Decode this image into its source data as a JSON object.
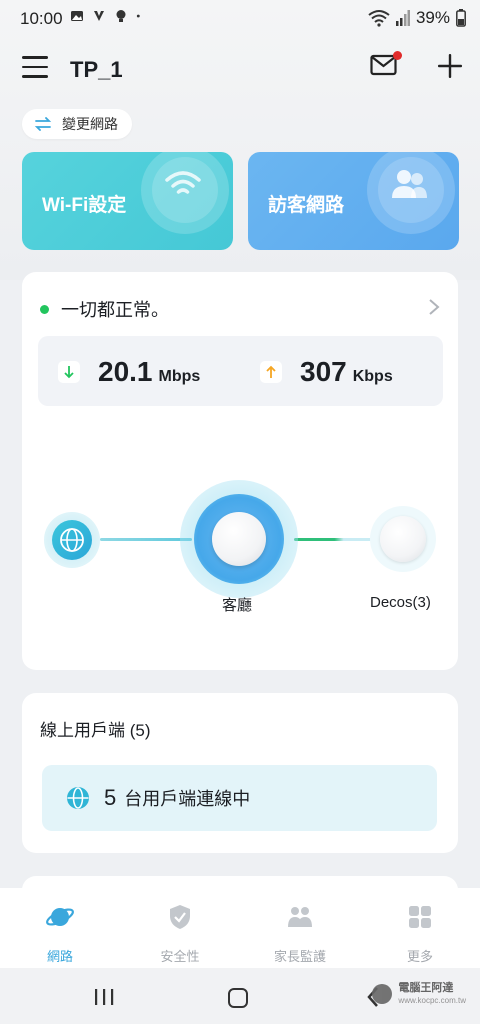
{
  "status_bar": {
    "time": "10:00",
    "battery": "39%"
  },
  "header": {
    "title": "TP_1",
    "menu_icon": "hamburger-icon",
    "mail_icon": "mail-icon",
    "add_icon": "plus-icon"
  },
  "change_network": {
    "label": "變更網路",
    "icon": "swap-icon"
  },
  "quick_cards": [
    {
      "label": "Wi-Fi設定",
      "icon": "wifi-icon",
      "color": "#4fcfda"
    },
    {
      "label": "訪客網路",
      "icon": "guests-icon",
      "color": "#62aff0"
    }
  ],
  "network_status": {
    "status_text": "一切都正常。",
    "status_color": "#22c55e",
    "download": {
      "value": "20.1",
      "unit": "Mbps",
      "icon": "arrow-down-icon"
    },
    "upload": {
      "value": "307",
      "unit": "Kbps",
      "icon": "arrow-up-icon"
    }
  },
  "topology": {
    "internet_icon": "globe-icon",
    "main_router_label": "客廳",
    "satellite_label": "Decos(3)"
  },
  "clients": {
    "title": "線上用戶端 (5)",
    "count": "5",
    "text": "台用戶端連線中",
    "icon": "globe-icon"
  },
  "bottom_nav": [
    {
      "label": "網路",
      "icon": "planet-icon",
      "active": true
    },
    {
      "label": "安全性",
      "icon": "shield-icon",
      "active": false
    },
    {
      "label": "家長監護",
      "icon": "family-icon",
      "active": false
    },
    {
      "label": "更多",
      "icon": "grid-icon",
      "active": false
    }
  ],
  "watermark": {
    "line1": "電腦王阿達",
    "line2": "www.kocpc.com.tw"
  },
  "colors": {
    "accent": "#3aa7dc",
    "page_bg": "#eef0f3"
  }
}
